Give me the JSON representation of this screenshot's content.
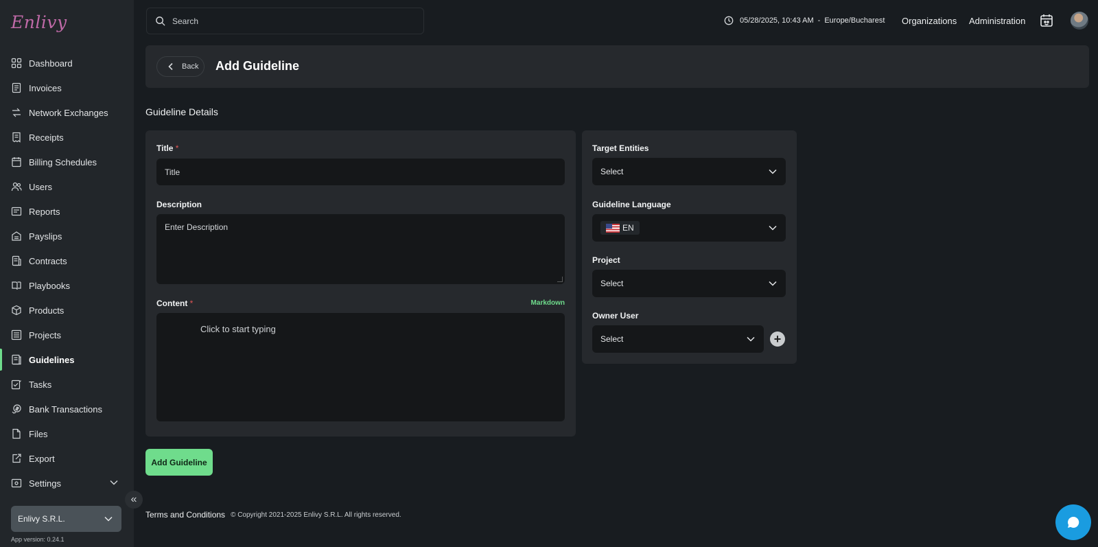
{
  "app": {
    "logo_text": "Enlivy"
  },
  "search": {
    "placeholder": "Search"
  },
  "topbar": {
    "datetime": "05/28/2025, 10:43 AM",
    "separator": "-",
    "timezone": "Europe/Bucharest",
    "organizations": "Organizations",
    "administration": "Administration"
  },
  "sidebar": {
    "items": [
      {
        "label": "Dashboard",
        "icon": "dashboard-icon"
      },
      {
        "label": "Invoices",
        "icon": "invoice-icon"
      },
      {
        "label": "Network Exchanges",
        "icon": "network-icon"
      },
      {
        "label": "Receipts",
        "icon": "receipt-icon"
      },
      {
        "label": "Billing Schedules",
        "icon": "billing-icon"
      },
      {
        "label": "Users",
        "icon": "users-icon"
      },
      {
        "label": "Reports",
        "icon": "reports-icon"
      },
      {
        "label": "Payslips",
        "icon": "payslip-icon"
      },
      {
        "label": "Contracts",
        "icon": "contracts-icon"
      },
      {
        "label": "Playbooks",
        "icon": "playbook-icon"
      },
      {
        "label": "Products",
        "icon": "products-icon"
      },
      {
        "label": "Projects",
        "icon": "projects-icon"
      },
      {
        "label": "Guidelines",
        "icon": "guidelines-icon"
      },
      {
        "label": "Tasks",
        "icon": "tasks-icon"
      },
      {
        "label": "Bank Transactions",
        "icon": "bank-icon"
      },
      {
        "label": "Files",
        "icon": "files-icon"
      },
      {
        "label": "Export",
        "icon": "export-icon"
      },
      {
        "label": "Settings",
        "icon": "settings-icon"
      }
    ],
    "active": "Guidelines",
    "org_name": "Enlivy S.R.L.",
    "app_version": "App version: 0.24.1"
  },
  "header": {
    "back_label": "Back",
    "title": "Add Guideline"
  },
  "form": {
    "section_title": "Guideline Details",
    "title_label": "Title",
    "required_mark": "*",
    "title_placeholder": "Title",
    "description_label": "Description",
    "description_placeholder": "Enter Description",
    "content_label": "Content",
    "markdown_tag": "Markdown",
    "content_placeholder": "Click to start typing",
    "target_entities_label": "Target Entities",
    "target_entities_value": "Select",
    "language_label": "Guideline Language",
    "language_value": "EN",
    "project_label": "Project",
    "project_value": "Select",
    "owner_label": "Owner User",
    "owner_value": "Select",
    "submit_label": "Add Guideline"
  },
  "footer": {
    "terms": "Terms and Conditions",
    "copyright": "© Copyright 2021-2025 Enlivy S.R.L. All rights reserved."
  },
  "colors": {
    "accent": "#6fdc8c",
    "chat": "#1a9ce0",
    "required": "#e05555"
  }
}
